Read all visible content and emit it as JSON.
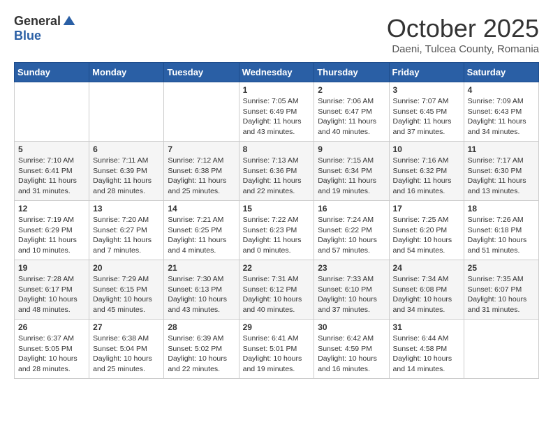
{
  "logo": {
    "general": "General",
    "blue": "Blue"
  },
  "title": "October 2025",
  "subtitle": "Daeni, Tulcea County, Romania",
  "days_of_week": [
    "Sunday",
    "Monday",
    "Tuesday",
    "Wednesday",
    "Thursday",
    "Friday",
    "Saturday"
  ],
  "weeks": [
    [
      {
        "day": "",
        "info": ""
      },
      {
        "day": "",
        "info": ""
      },
      {
        "day": "",
        "info": ""
      },
      {
        "day": "1",
        "info": "Sunrise: 7:05 AM\nSunset: 6:49 PM\nDaylight: 11 hours and 43 minutes."
      },
      {
        "day": "2",
        "info": "Sunrise: 7:06 AM\nSunset: 6:47 PM\nDaylight: 11 hours and 40 minutes."
      },
      {
        "day": "3",
        "info": "Sunrise: 7:07 AM\nSunset: 6:45 PM\nDaylight: 11 hours and 37 minutes."
      },
      {
        "day": "4",
        "info": "Sunrise: 7:09 AM\nSunset: 6:43 PM\nDaylight: 11 hours and 34 minutes."
      }
    ],
    [
      {
        "day": "5",
        "info": "Sunrise: 7:10 AM\nSunset: 6:41 PM\nDaylight: 11 hours and 31 minutes."
      },
      {
        "day": "6",
        "info": "Sunrise: 7:11 AM\nSunset: 6:39 PM\nDaylight: 11 hours and 28 minutes."
      },
      {
        "day": "7",
        "info": "Sunrise: 7:12 AM\nSunset: 6:38 PM\nDaylight: 11 hours and 25 minutes."
      },
      {
        "day": "8",
        "info": "Sunrise: 7:13 AM\nSunset: 6:36 PM\nDaylight: 11 hours and 22 minutes."
      },
      {
        "day": "9",
        "info": "Sunrise: 7:15 AM\nSunset: 6:34 PM\nDaylight: 11 hours and 19 minutes."
      },
      {
        "day": "10",
        "info": "Sunrise: 7:16 AM\nSunset: 6:32 PM\nDaylight: 11 hours and 16 minutes."
      },
      {
        "day": "11",
        "info": "Sunrise: 7:17 AM\nSunset: 6:30 PM\nDaylight: 11 hours and 13 minutes."
      }
    ],
    [
      {
        "day": "12",
        "info": "Sunrise: 7:19 AM\nSunset: 6:29 PM\nDaylight: 11 hours and 10 minutes."
      },
      {
        "day": "13",
        "info": "Sunrise: 7:20 AM\nSunset: 6:27 PM\nDaylight: 11 hours and 7 minutes."
      },
      {
        "day": "14",
        "info": "Sunrise: 7:21 AM\nSunset: 6:25 PM\nDaylight: 11 hours and 4 minutes."
      },
      {
        "day": "15",
        "info": "Sunrise: 7:22 AM\nSunset: 6:23 PM\nDaylight: 11 hours and 0 minutes."
      },
      {
        "day": "16",
        "info": "Sunrise: 7:24 AM\nSunset: 6:22 PM\nDaylight: 10 hours and 57 minutes."
      },
      {
        "day": "17",
        "info": "Sunrise: 7:25 AM\nSunset: 6:20 PM\nDaylight: 10 hours and 54 minutes."
      },
      {
        "day": "18",
        "info": "Sunrise: 7:26 AM\nSunset: 6:18 PM\nDaylight: 10 hours and 51 minutes."
      }
    ],
    [
      {
        "day": "19",
        "info": "Sunrise: 7:28 AM\nSunset: 6:17 PM\nDaylight: 10 hours and 48 minutes."
      },
      {
        "day": "20",
        "info": "Sunrise: 7:29 AM\nSunset: 6:15 PM\nDaylight: 10 hours and 45 minutes."
      },
      {
        "day": "21",
        "info": "Sunrise: 7:30 AM\nSunset: 6:13 PM\nDaylight: 10 hours and 43 minutes."
      },
      {
        "day": "22",
        "info": "Sunrise: 7:31 AM\nSunset: 6:12 PM\nDaylight: 10 hours and 40 minutes."
      },
      {
        "day": "23",
        "info": "Sunrise: 7:33 AM\nSunset: 6:10 PM\nDaylight: 10 hours and 37 minutes."
      },
      {
        "day": "24",
        "info": "Sunrise: 7:34 AM\nSunset: 6:08 PM\nDaylight: 10 hours and 34 minutes."
      },
      {
        "day": "25",
        "info": "Sunrise: 7:35 AM\nSunset: 6:07 PM\nDaylight: 10 hours and 31 minutes."
      }
    ],
    [
      {
        "day": "26",
        "info": "Sunrise: 6:37 AM\nSunset: 5:05 PM\nDaylight: 10 hours and 28 minutes."
      },
      {
        "day": "27",
        "info": "Sunrise: 6:38 AM\nSunset: 5:04 PM\nDaylight: 10 hours and 25 minutes."
      },
      {
        "day": "28",
        "info": "Sunrise: 6:39 AM\nSunset: 5:02 PM\nDaylight: 10 hours and 22 minutes."
      },
      {
        "day": "29",
        "info": "Sunrise: 6:41 AM\nSunset: 5:01 PM\nDaylight: 10 hours and 19 minutes."
      },
      {
        "day": "30",
        "info": "Sunrise: 6:42 AM\nSunset: 4:59 PM\nDaylight: 10 hours and 16 minutes."
      },
      {
        "day": "31",
        "info": "Sunrise: 6:44 AM\nSunset: 4:58 PM\nDaylight: 10 hours and 14 minutes."
      },
      {
        "day": "",
        "info": ""
      }
    ]
  ]
}
